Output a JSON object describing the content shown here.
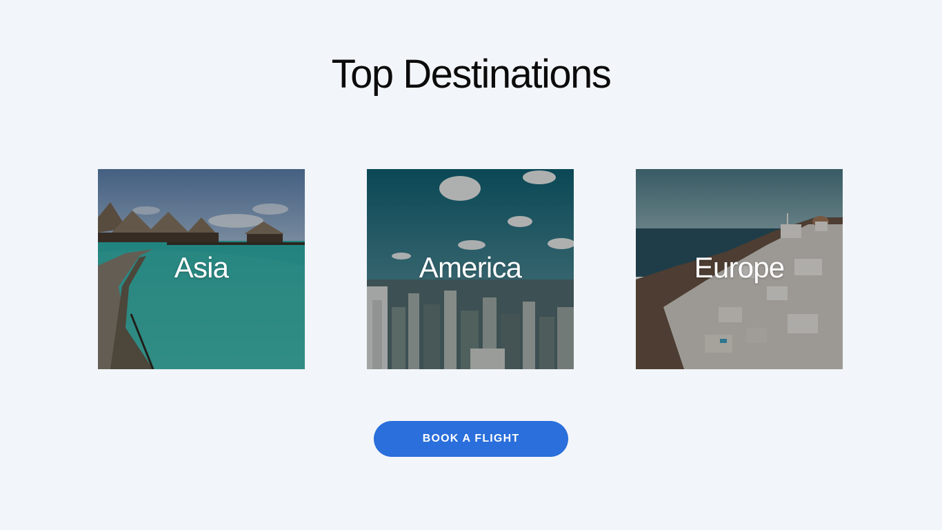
{
  "header": {
    "title": "Top Destinations"
  },
  "destinations": [
    {
      "label": "Asia",
      "image": "overwater-bungalows-photo"
    },
    {
      "label": "America",
      "image": "city-skyline-photo"
    },
    {
      "label": "Europe",
      "image": "santorini-village-photo"
    }
  ],
  "cta": {
    "label": "BOOK A FLIGHT",
    "color": "#2a6fdb"
  },
  "theme": {
    "background": "#f2f5f9",
    "text": "#0b0b0b"
  }
}
